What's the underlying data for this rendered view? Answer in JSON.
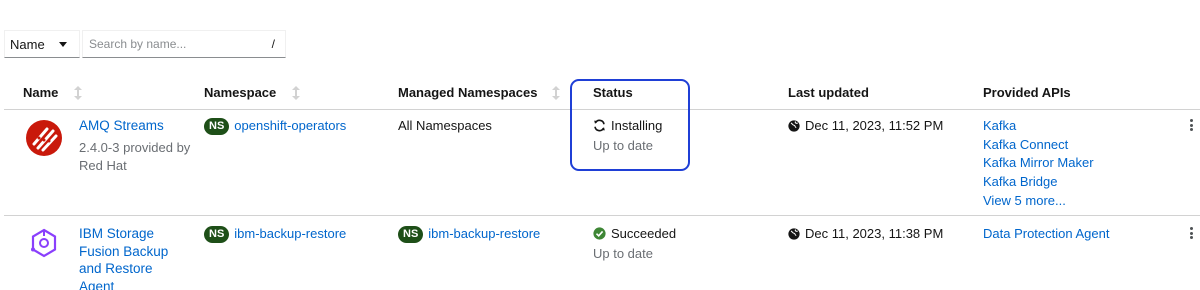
{
  "filter": {
    "select_label": "Name",
    "search_placeholder": "Search by name...",
    "shortcut": "/"
  },
  "table": {
    "headers": {
      "name": "Name",
      "namespace": "Namespace",
      "managed_namespaces": "Managed Namespaces",
      "status": "Status",
      "last_updated": "Last updated",
      "provided_apis": "Provided APIs"
    },
    "rows": [
      {
        "name": "AMQ Streams",
        "provider_line1": "2.4.0-3 provided by",
        "provider_line2": "Red Hat",
        "ns_badge": "NS",
        "namespace": "openshift-operators",
        "managed_namespaces": "All Namespaces",
        "status": "Installing",
        "status_sub": "Up to date",
        "last_updated": "Dec 11, 2023, 11:52 PM",
        "apis": [
          "Kafka",
          "Kafka Connect",
          "Kafka Mirror Maker",
          "Kafka Bridge",
          "View 5 more..."
        ]
      },
      {
        "name_line1": "IBM Storage",
        "name_line2": "Fusion Backup",
        "name_line3": "and Restore",
        "name_line4": "Agent",
        "ns_badge": "NS",
        "namespace": "ibm-backup-restore",
        "managed_badge": "NS",
        "managed_namespaces": "ibm-backup-restore",
        "status": "Succeeded",
        "status_sub": "Up to date",
        "last_updated": "Dec 11, 2023, 11:38 PM",
        "apis": [
          "Data Protection Agent"
        ]
      }
    ]
  },
  "colors": {
    "link": "#0066cc",
    "ns_badge": "#1e4f18",
    "success": "#3e8635",
    "highlight": "#1f3fd6",
    "amq_logo": "#c9190b",
    "ibm_logo": "#8a3ffc"
  }
}
